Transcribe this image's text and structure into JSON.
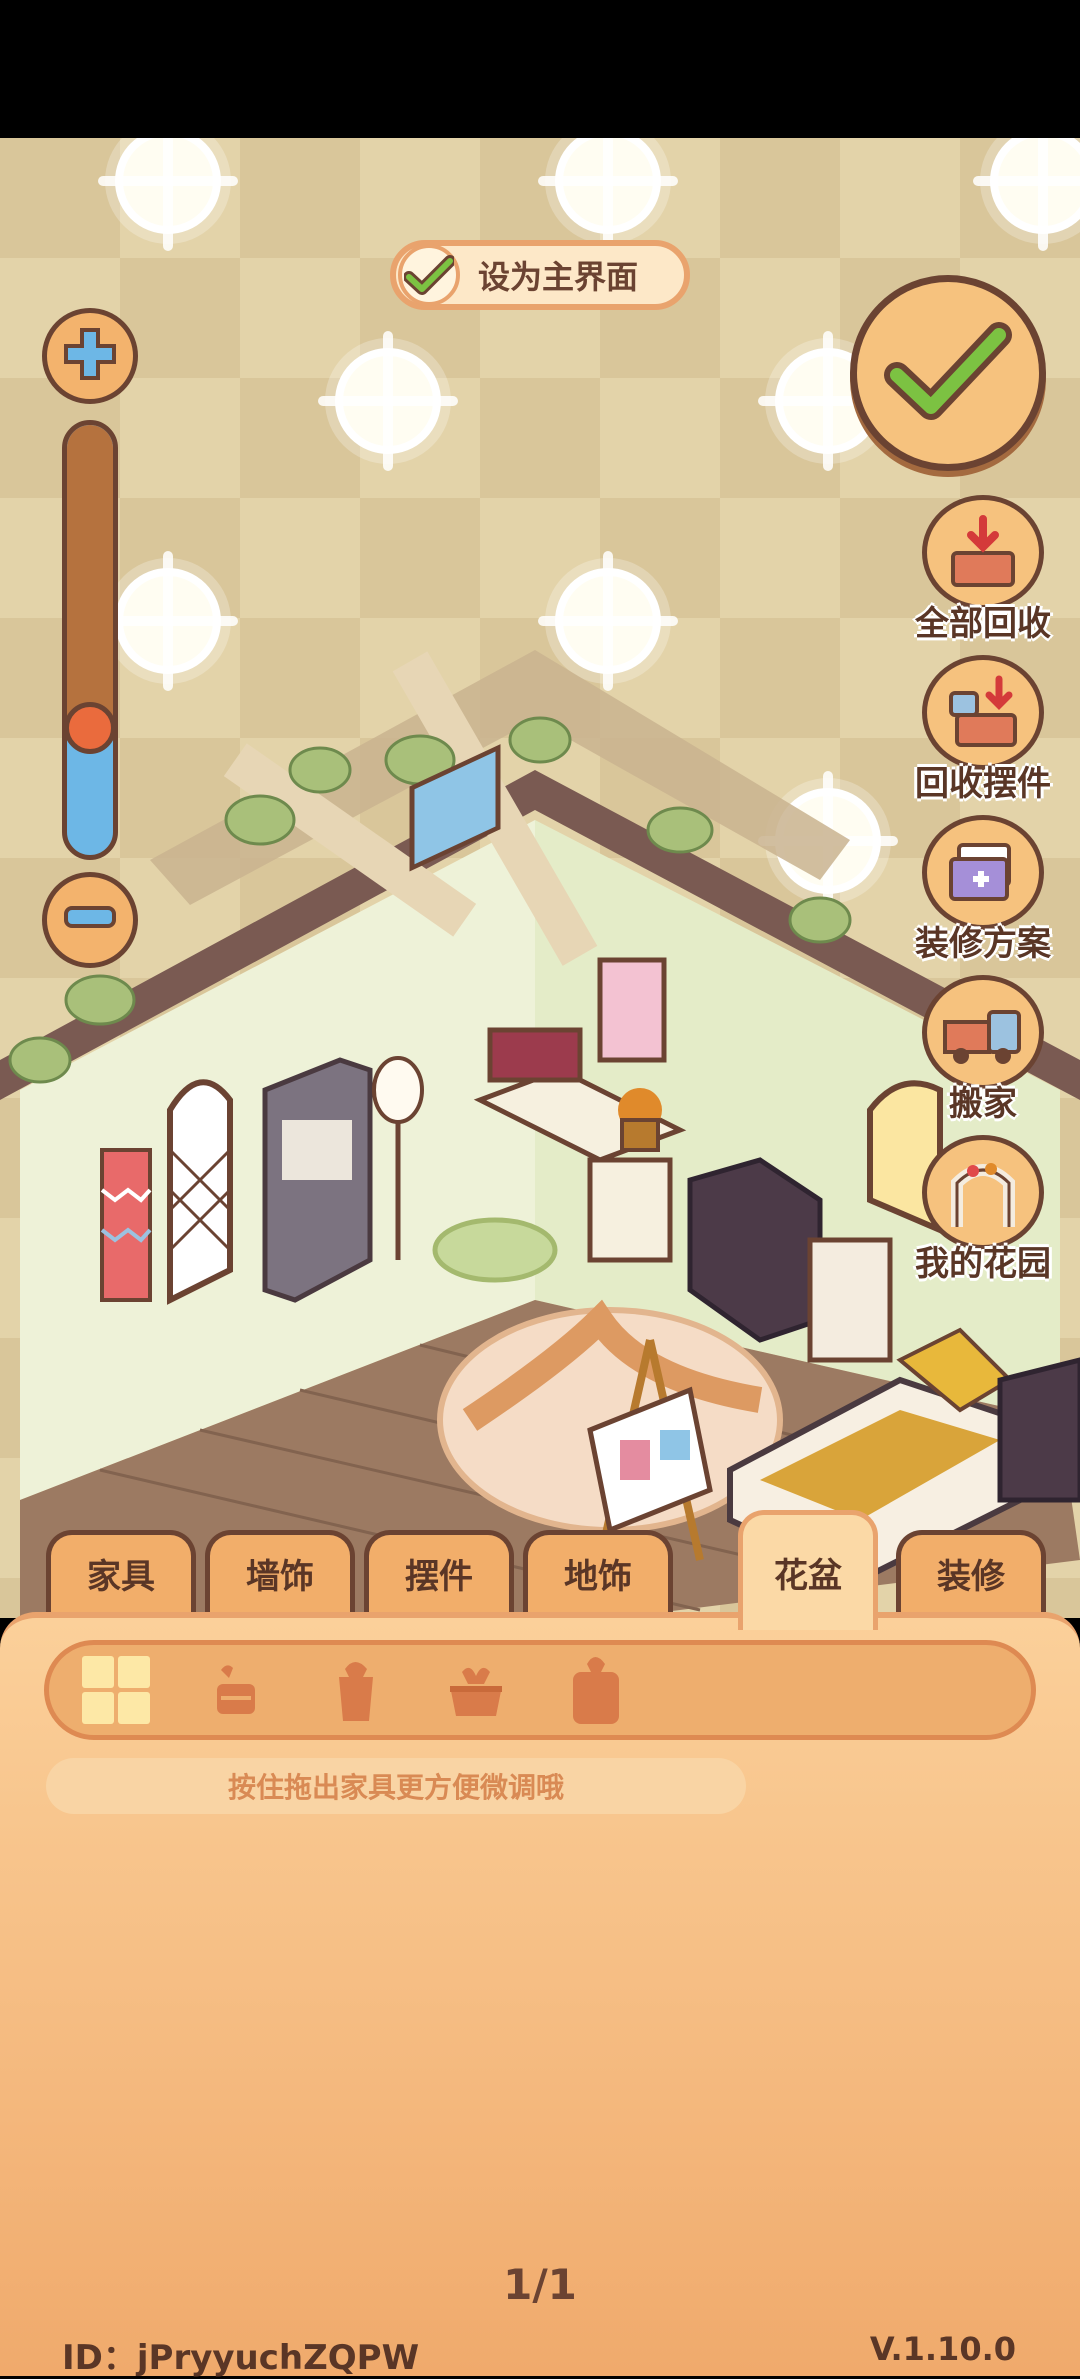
{
  "top_bar": {
    "set_home_label": "设为主界面",
    "set_home_checked": true
  },
  "zoom": {
    "level": 0.3
  },
  "side_buttons": [
    {
      "label": "全部回收",
      "icon": "recycle-all-icon"
    },
    {
      "label": "回收摆件",
      "icon": "recycle-ornament-icon"
    },
    {
      "label": "装修方案",
      "icon": "decor-plan-icon"
    },
    {
      "label": "搬家",
      "icon": "moving-truck-icon"
    },
    {
      "label": "我的花园",
      "icon": "garden-arch-icon"
    }
  ],
  "tabs": [
    {
      "label": "家具",
      "active": false
    },
    {
      "label": "墙饰",
      "active": false
    },
    {
      "label": "摆件",
      "active": false
    },
    {
      "label": "地饰",
      "active": false
    },
    {
      "label": "花盆",
      "active": true
    },
    {
      "label": "装修",
      "active": false
    }
  ],
  "filters": [
    {
      "icon": "grid-all-icon",
      "selected": true
    },
    {
      "icon": "small-pot-icon",
      "selected": false
    },
    {
      "icon": "tall-pot-icon",
      "selected": false
    },
    {
      "icon": "bowl-pot-icon",
      "selected": false
    },
    {
      "icon": "box-pot-icon",
      "selected": false
    }
  ],
  "hint_text": "按住拖出家具更方便微调哦",
  "pagination": "1/1",
  "footer": {
    "user_id": "ID：jPryyuchZQPW",
    "version": "V.1.10.0"
  },
  "colors": {
    "panel": "#f0aa6c",
    "outline": "#6b4332",
    "accent_green": "#7cc242"
  }
}
